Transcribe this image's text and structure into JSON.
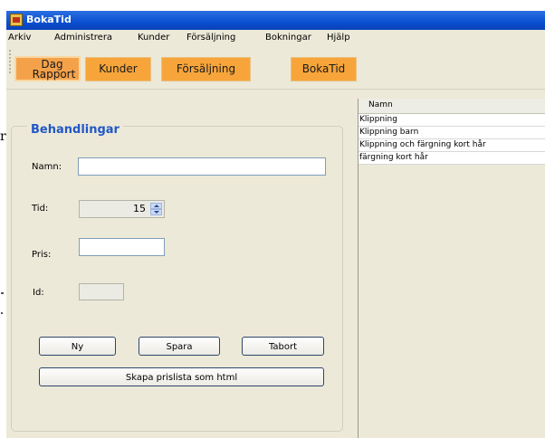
{
  "window": {
    "title": "BokaTid"
  },
  "menubar": {
    "items": [
      "Arkiv",
      "Administrera",
      "Kunder",
      "Försäljning",
      "Bokningar",
      "Hjälp"
    ]
  },
  "toolbar": {
    "buttons": [
      {
        "label_line1": "Dag",
        "label_line2": "Rapport"
      },
      {
        "label": "Kunder"
      },
      {
        "label": "Försäljning"
      },
      {
        "label": "BokaTid"
      }
    ]
  },
  "form": {
    "title": "Behandlingar",
    "name_label": "Namn:",
    "name_value": "",
    "tid_label": "Tid:",
    "tid_value": "15",
    "pris_label": "Pris:",
    "pris_value": "",
    "id_label": "Id:",
    "id_value": "",
    "new_button": "Ny",
    "save_button": "Spara",
    "delete_button": "Tabort",
    "export_button": "Skapa prislista som html"
  },
  "list": {
    "header": "Namn",
    "rows": [
      "Klippning",
      "Klippning barn",
      "Klippning och färgning kort hår",
      "färgning kort hår"
    ]
  },
  "margin": {
    "char": "r"
  }
}
